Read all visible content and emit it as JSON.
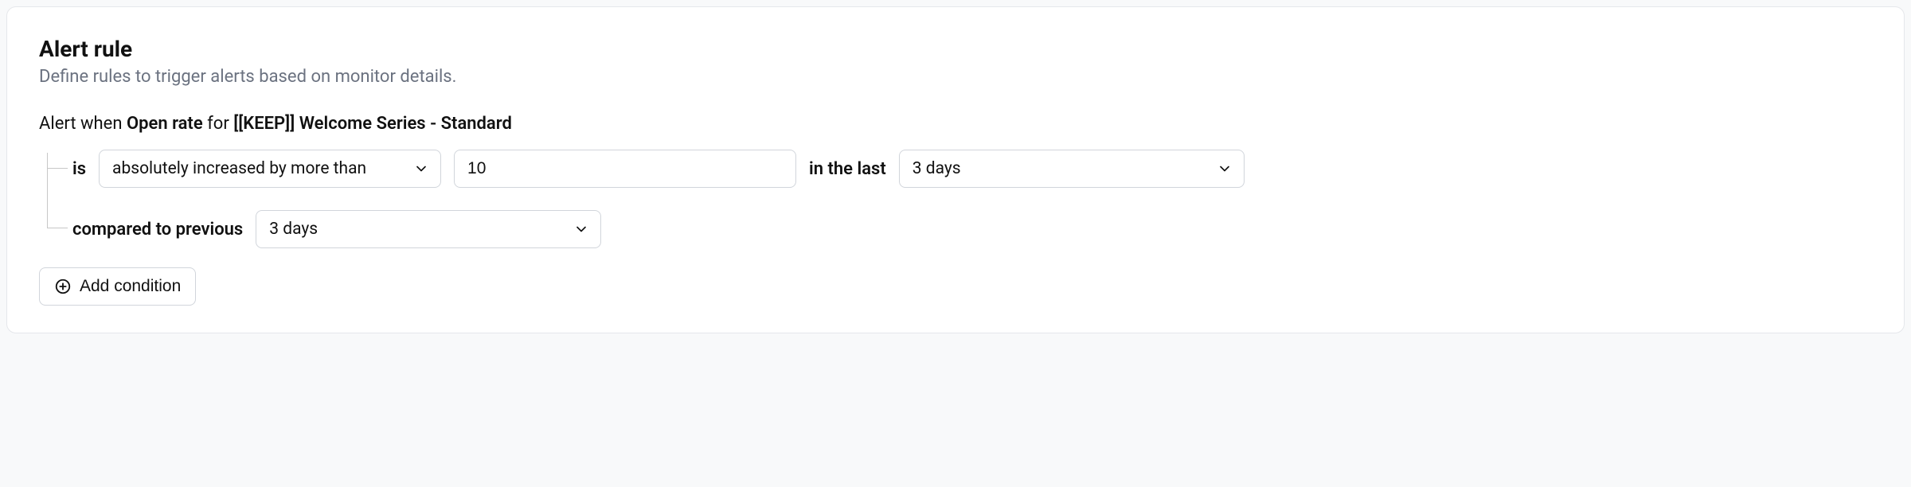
{
  "header": {
    "title": "Alert rule",
    "subtitle": "Define rules to trigger alerts based on monitor details."
  },
  "whenLine": {
    "prefix": "Alert when ",
    "metric": "Open rate",
    "mid": " for ",
    "target": "[[KEEP]] Welcome Series - Standard"
  },
  "conditions": {
    "isLabel": "is",
    "operator": "absolutely increased by more than",
    "value": "10",
    "inTheLastLabel": "in the last",
    "period": "3 days",
    "comparedLabel": "compared to previous",
    "prevPeriod": "3 days"
  },
  "addButton": {
    "label": "Add condition"
  }
}
